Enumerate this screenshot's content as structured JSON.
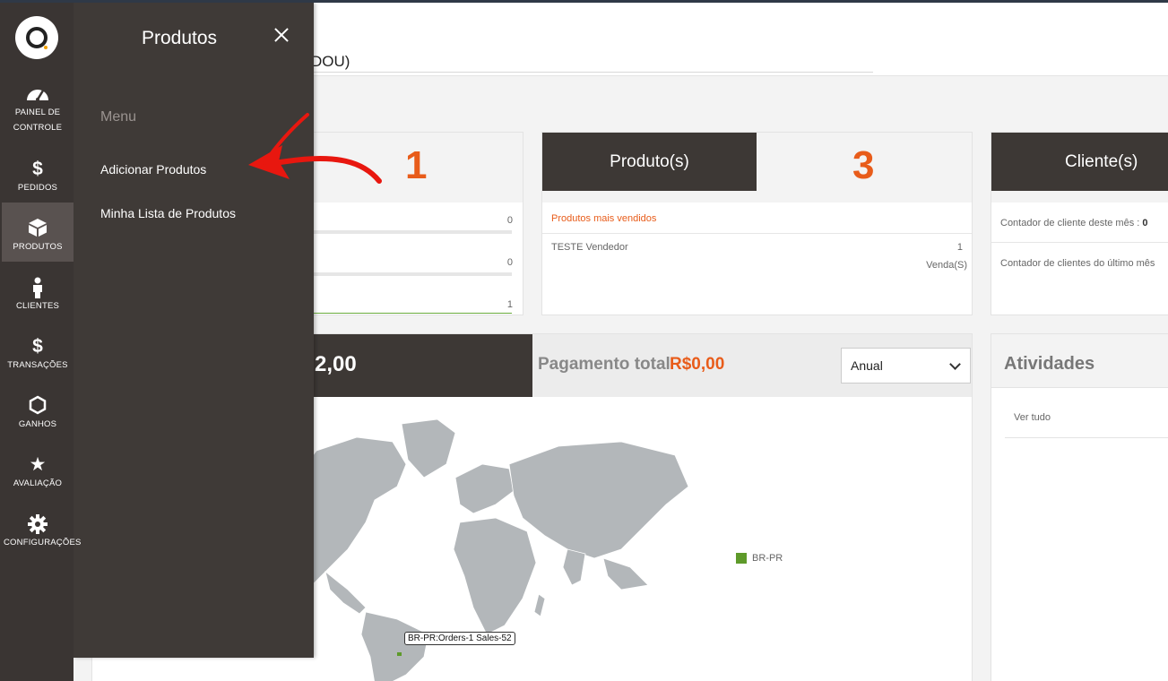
{
  "header": {
    "store_name_fragment": "DOU)"
  },
  "sidebar": {
    "items": [
      {
        "label": "PAINEL DE CONTROLE",
        "icon": "dashboard-icon"
      },
      {
        "label": "PEDIDOS",
        "icon": "dollar-icon"
      },
      {
        "label": "PRODUTOS",
        "icon": "box-icon",
        "active": true
      },
      {
        "label": "CLIENTES",
        "icon": "person-icon"
      },
      {
        "label": "TRANSAÇÕES",
        "icon": "dollar-icon"
      },
      {
        "label": "GANHOS",
        "icon": "hexagon-icon"
      },
      {
        "label": "AVALIAÇÃO",
        "icon": "star-icon"
      },
      {
        "label": "CONFIGURAÇÕES",
        "icon": "gear-icon"
      }
    ]
  },
  "flyout": {
    "title": "Produtos",
    "menu_heading": "Menu",
    "items": [
      "Adicionar Produtos",
      "Minha Lista de Produtos"
    ]
  },
  "annotation": {
    "number": "1",
    "color": "#e8170f"
  },
  "orders_card": {
    "rows": [
      {
        "value": "0"
      },
      {
        "value": "0"
      },
      {
        "value": "1"
      }
    ]
  },
  "products_card": {
    "label": "Produto(s)",
    "count": "3",
    "subtitle": "Produtos mais vendidos",
    "top_product": {
      "name": "TESTE Vendedor",
      "qty": "1",
      "unit": "Venda(S)"
    }
  },
  "clients_card": {
    "label": "Cliente(s)",
    "this_month_label": "Contador de cliente deste mês : ",
    "this_month_value": "0",
    "last_month_label": "Contador de clientes do último mês"
  },
  "revenue": {
    "amount_fragment": "2,00",
    "payment_label": "Pagamento total",
    "payment_value": "R$0,00",
    "period_select": "Anual",
    "map_legend": "BR-PR",
    "map_tooltip": "BR-PR:Orders-1 Sales-52"
  },
  "activities": {
    "title": "Atividades",
    "view_all": "Ver tudo"
  },
  "colors": {
    "sidebar": "#3a3533",
    "flyout": "#3f3a37",
    "accent": "#e85c1a",
    "map_highlight": "#5e9a2a"
  }
}
